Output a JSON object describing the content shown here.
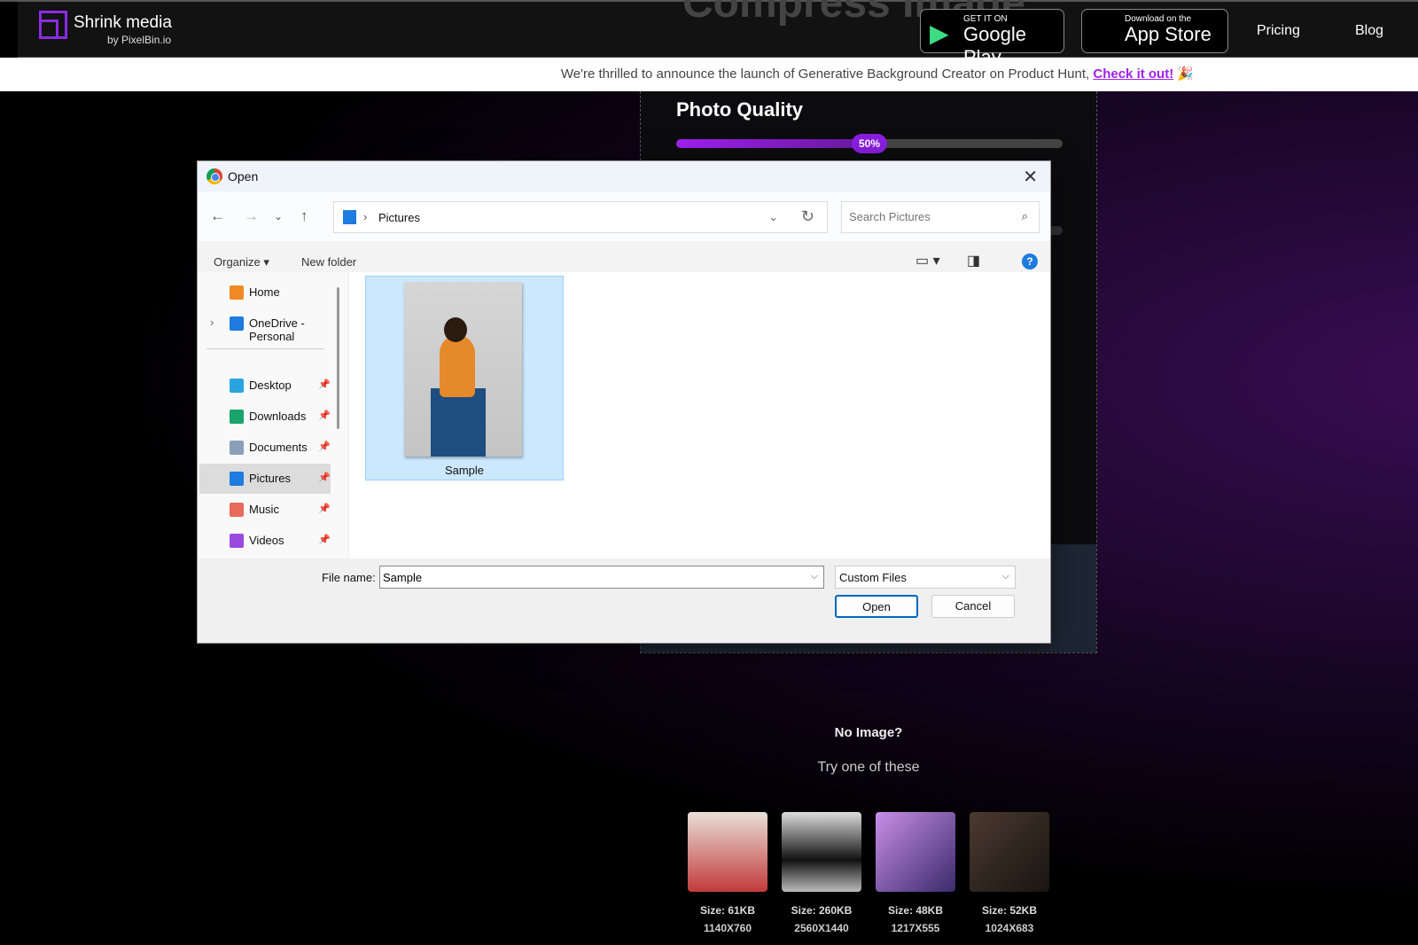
{
  "header": {
    "brand": "Shrink media",
    "brand_sub": "by PixelBin.io",
    "hero_text": "Compress Image",
    "google_play": {
      "small": "GET IT ON",
      "big": "Google Play"
    },
    "app_store": {
      "small": "Download on the",
      "big": "App Store"
    },
    "nav": [
      "Pricing",
      "Blog"
    ]
  },
  "announcement": {
    "text": "We're thrilled to announce the launch of Generative Background Creator on Product Hunt,",
    "link": "Check it out!",
    "emoji": "🎉"
  },
  "quality": {
    "title": "Photo Quality",
    "value": 50,
    "label": "50%",
    "accent": "#a020f0"
  },
  "dialog": {
    "title": "Open",
    "close": "✕",
    "path": "Pictures",
    "search_placeholder": "Search Pictures",
    "toolbar": {
      "organize": "Organize ▾",
      "new_folder": "New folder",
      "help": "?"
    },
    "sidebar": [
      {
        "label": "Home",
        "icon": "home-icon",
        "color": "#f08a24"
      },
      {
        "label": "OneDrive - Personal",
        "icon": "onedrive-icon",
        "color": "#1e7be0"
      },
      {
        "label": "Desktop",
        "icon": "desktop-icon",
        "color": "#2aa3e0",
        "pinned": true
      },
      {
        "label": "Downloads",
        "icon": "download-icon",
        "color": "#1aa36b",
        "pinned": true
      },
      {
        "label": "Documents",
        "icon": "documents-icon",
        "color": "#8aa0b8",
        "pinned": true
      },
      {
        "label": "Pictures",
        "icon": "pictures-icon",
        "color": "#1e7be0",
        "pinned": true,
        "selected": true
      },
      {
        "label": "Music",
        "icon": "music-icon",
        "color": "#e86a5a",
        "pinned": true
      },
      {
        "label": "Videos",
        "icon": "videos-icon",
        "color": "#9a4ae0",
        "pinned": true
      }
    ],
    "files": [
      {
        "name": "Sample",
        "selected": true
      }
    ],
    "file_name_label": "File name:",
    "file_name": "Sample",
    "file_type": "Custom Files",
    "open": "Open",
    "cancel": "Cancel"
  },
  "samples": {
    "title": "No Image?",
    "subtitle": "Try one of these",
    "items": [
      {
        "size": "Size: 61KB",
        "dims": "1140X760"
      },
      {
        "size": "Size: 260KB",
        "dims": "2560X1440"
      },
      {
        "size": "Size: 48KB",
        "dims": "1217X555"
      },
      {
        "size": "Size: 52KB",
        "dims": "1024X683"
      }
    ]
  }
}
